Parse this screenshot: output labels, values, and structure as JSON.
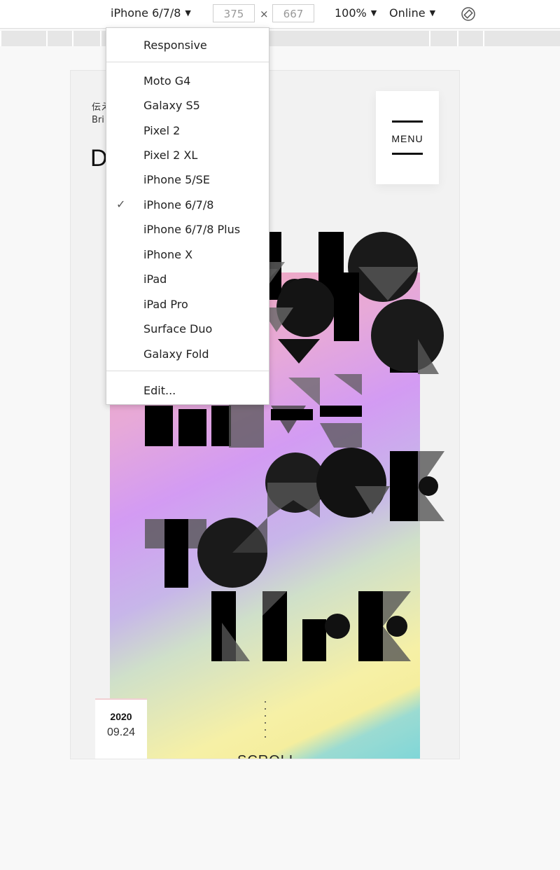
{
  "toolbar": {
    "device": "iPhone 6/7/8",
    "width": "375",
    "height": "667",
    "separator": "×",
    "zoom": "100%",
    "network": "Online",
    "caret": "▼"
  },
  "dropdown": {
    "responsive": "Responsive",
    "devices": [
      "Moto G4",
      "Galaxy S5",
      "Pixel 2",
      "Pixel 2 XL",
      "iPhone 5/SE",
      "iPhone 6/7/8",
      "iPhone 6/7/8 Plus",
      "iPhone X",
      "iPad",
      "iPad Pro",
      "Surface Duo",
      "Galaxy Fold"
    ],
    "selected": "iPhone 6/7/8",
    "check": "✓",
    "edit": "Edit..."
  },
  "page": {
    "jp_partial": "伝え",
    "en_partial": "Bri",
    "heading_partial": "D",
    "menu_label": "MENU",
    "date_year": "2020",
    "date_md": "09.24",
    "scroll_label": "SCROLL"
  },
  "colors": {
    "toolbar_bg": "#ffffff",
    "poster_pink": "#f4a9b6",
    "poster_violet": "#d39bf3",
    "poster_yellow": "#f6f0a6",
    "poster_teal": "#7fd6d8"
  }
}
